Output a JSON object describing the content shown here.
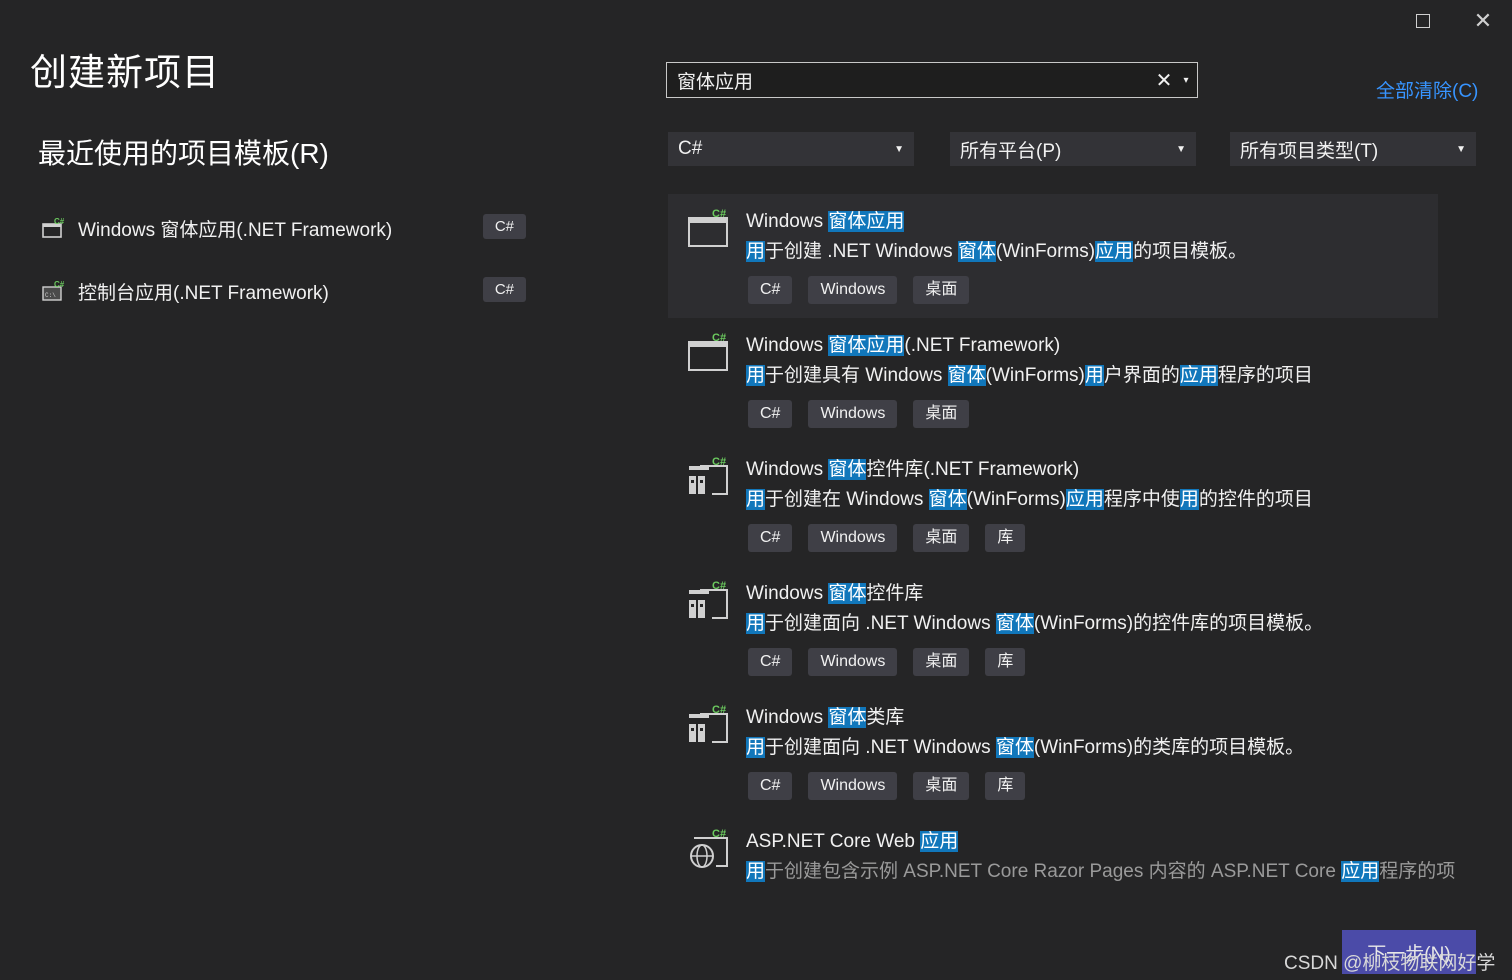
{
  "window": {
    "maximize": "maximize",
    "close": "close"
  },
  "page_title": "创建新项目",
  "recent": {
    "title": "最近使用的项目模板(R)",
    "items": [
      {
        "label": "Windows 窗体应用(.NET Framework)",
        "tag": "C#",
        "icon": "winforms-icon"
      },
      {
        "label": "控制台应用(.NET Framework)",
        "tag": "C#",
        "icon": "console-icon"
      }
    ]
  },
  "search": {
    "value": "窗体应用",
    "clear": "✕",
    "dropdown": "▾"
  },
  "clear_all": "全部清除(C)",
  "filters": {
    "language": "C#",
    "platform": "所有平台(P)",
    "project_type": "所有项目类型(T)"
  },
  "templates": [
    {
      "title": [
        [
          "Windows ",
          false
        ],
        [
          "窗体应用",
          true
        ]
      ],
      "desc": [
        [
          "用",
          true
        ],
        [
          "于创建 .NET Windows ",
          false
        ],
        [
          "窗体",
          true
        ],
        [
          "(WinForms)",
          false
        ],
        [
          "应用",
          true
        ],
        [
          "的项目模板。",
          false
        ]
      ],
      "tags": [
        "C#",
        "Windows",
        "桌面"
      ],
      "icon": "winforms-app-icon",
      "selected": true
    },
    {
      "title": [
        [
          "Windows ",
          false
        ],
        [
          "窗体应用",
          true
        ],
        [
          "(.NET Framework)",
          false
        ]
      ],
      "desc": [
        [
          "用",
          true
        ],
        [
          "于创建具有 Windows ",
          false
        ],
        [
          "窗体",
          true
        ],
        [
          "(WinForms)",
          false
        ],
        [
          "用",
          true
        ],
        [
          "户界面的",
          false
        ],
        [
          "应用",
          true
        ],
        [
          "程序的项目",
          false
        ]
      ],
      "tags": [
        "C#",
        "Windows",
        "桌面"
      ],
      "icon": "winforms-app-icon"
    },
    {
      "title": [
        [
          "Windows ",
          false
        ],
        [
          "窗体",
          true
        ],
        [
          "控件库(.NET Framework)",
          false
        ]
      ],
      "desc": [
        [
          "用",
          true
        ],
        [
          "于创建在 Windows ",
          false
        ],
        [
          "窗体",
          true
        ],
        [
          "(WinForms)",
          false
        ],
        [
          "应用",
          true
        ],
        [
          "程序中使",
          false
        ],
        [
          "用",
          true
        ],
        [
          "的控件的项目",
          false
        ]
      ],
      "tags": [
        "C#",
        "Windows",
        "桌面",
        "库"
      ],
      "icon": "control-library-icon"
    },
    {
      "title": [
        [
          "Windows ",
          false
        ],
        [
          "窗体",
          true
        ],
        [
          "控件库",
          false
        ]
      ],
      "desc": [
        [
          "用",
          true
        ],
        [
          "于创建面向 .NET Windows ",
          false
        ],
        [
          "窗体",
          true
        ],
        [
          "(WinForms)的控件库的项目模板。",
          false
        ]
      ],
      "tags": [
        "C#",
        "Windows",
        "桌面",
        "库"
      ],
      "icon": "control-library-icon"
    },
    {
      "title": [
        [
          "Windows ",
          false
        ],
        [
          "窗体",
          true
        ],
        [
          "类库",
          false
        ]
      ],
      "desc": [
        [
          "用",
          true
        ],
        [
          "于创建面向 .NET Windows ",
          false
        ],
        [
          "窗体",
          true
        ],
        [
          "(WinForms)的类库的项目模板。",
          false
        ]
      ],
      "tags": [
        "C#",
        "Windows",
        "桌面",
        "库"
      ],
      "icon": "class-library-icon"
    },
    {
      "title": [
        [
          "ASP.NET Core Web ",
          false
        ],
        [
          "应用",
          true
        ]
      ],
      "desc": [
        [
          "用",
          true
        ],
        [
          "于创建包含示例 ASP.NET Core Razor Pages 内容的 ASP.NET Core ",
          false
        ],
        [
          "应用",
          true
        ],
        [
          "程序的项",
          false
        ]
      ],
      "tags": [],
      "icon": "web-app-icon",
      "faded": true
    }
  ],
  "next_button": "下一步(N)",
  "watermark": "CSDN @柳枝物联网好学",
  "colors": {
    "background": "#252526",
    "highlight": "#1177bb",
    "link": "#3794ff",
    "tag_bg": "#3f3f46"
  }
}
